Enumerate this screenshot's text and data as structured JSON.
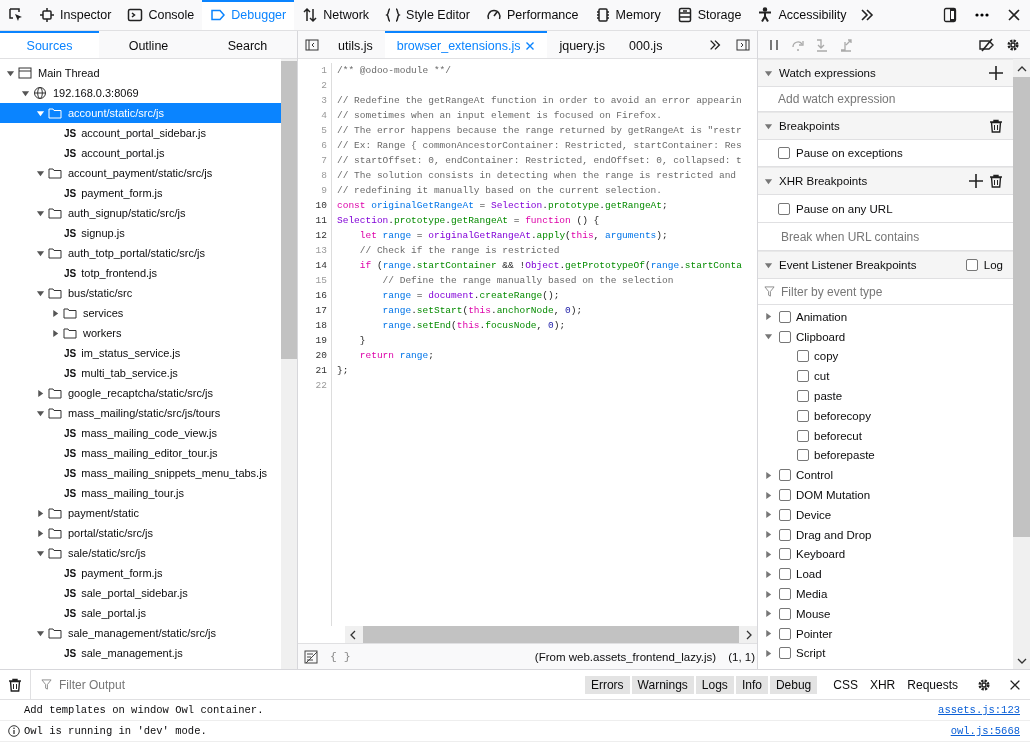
{
  "toolbox": {
    "tools": [
      {
        "label": "Inspector",
        "selected": false
      },
      {
        "label": "Console",
        "selected": false
      },
      {
        "label": "Debugger",
        "selected": true
      },
      {
        "label": "Network",
        "selected": false
      },
      {
        "label": "Style Editor",
        "selected": false
      },
      {
        "label": "Performance",
        "selected": false
      },
      {
        "label": "Memory",
        "selected": false
      },
      {
        "label": "Storage",
        "selected": false
      },
      {
        "label": "Accessibility",
        "selected": false
      }
    ]
  },
  "sources": {
    "tabs": [
      {
        "label": "Sources",
        "selected": true
      },
      {
        "label": "Outline",
        "selected": false
      },
      {
        "label": "Search",
        "selected": false
      }
    ],
    "tree": [
      {
        "kind": "thread",
        "label": "Main Thread",
        "expanded": true,
        "selected": false,
        "children": [
          {
            "kind": "host",
            "label": "192.168.0.3:8069",
            "expanded": true,
            "selected": false,
            "children": [
              {
                "kind": "folder",
                "label": "account/static/src/js",
                "expanded": true,
                "selected": true,
                "children": [
                  {
                    "kind": "file",
                    "badge": "JS",
                    "label": "account_portal_sidebar.js",
                    "selected": false
                  },
                  {
                    "kind": "file",
                    "badge": "JS",
                    "label": "account_portal.js",
                    "selected": false
                  }
                ]
              },
              {
                "kind": "folder",
                "label": "account_payment/static/src/js",
                "expanded": true,
                "selected": false,
                "children": [
                  {
                    "kind": "file",
                    "badge": "JS",
                    "label": "payment_form.js",
                    "selected": false
                  }
                ]
              },
              {
                "kind": "folder",
                "label": "auth_signup/static/src/js",
                "expanded": true,
                "selected": false,
                "children": [
                  {
                    "kind": "file",
                    "badge": "JS",
                    "label": "signup.js",
                    "selected": false
                  }
                ]
              },
              {
                "kind": "folder",
                "label": "auth_totp_portal/static/src/js",
                "expanded": true,
                "selected": false,
                "children": [
                  {
                    "kind": "file",
                    "badge": "JS",
                    "label": "totp_frontend.js",
                    "selected": false
                  }
                ]
              },
              {
                "kind": "folder",
                "label": "bus/static/src",
                "expanded": true,
                "selected": false,
                "children": [
                  {
                    "kind": "folder",
                    "label": "services",
                    "expanded": false,
                    "selected": false
                  },
                  {
                    "kind": "folder",
                    "label": "workers",
                    "expanded": false,
                    "selected": false
                  },
                  {
                    "kind": "file",
                    "badge": "JS",
                    "label": "im_status_service.js",
                    "selected": false
                  },
                  {
                    "kind": "file",
                    "badge": "JS",
                    "label": "multi_tab_service.js",
                    "selected": false
                  }
                ]
              },
              {
                "kind": "folder",
                "label": "google_recaptcha/static/src/js",
                "expanded": false,
                "selected": false
              },
              {
                "kind": "folder",
                "label": "mass_mailing/static/src/js/tours",
                "expanded": true,
                "selected": false,
                "children": [
                  {
                    "kind": "file",
                    "badge": "JS",
                    "label": "mass_mailing_code_view.js",
                    "selected": false
                  },
                  {
                    "kind": "file",
                    "badge": "JS",
                    "label": "mass_mailing_editor_tour.js",
                    "selected": false
                  },
                  {
                    "kind": "file",
                    "badge": "JS",
                    "label": "mass_mailing_snippets_menu_tabs.js",
                    "selected": false
                  },
                  {
                    "kind": "file",
                    "badge": "JS",
                    "label": "mass_mailing_tour.js",
                    "selected": false
                  }
                ]
              },
              {
                "kind": "folder",
                "label": "payment/static",
                "expanded": false,
                "selected": false
              },
              {
                "kind": "folder",
                "label": "portal/static/src/js",
                "expanded": false,
                "selected": false
              },
              {
                "kind": "folder",
                "label": "sale/static/src/js",
                "expanded": true,
                "selected": false,
                "children": [
                  {
                    "kind": "file",
                    "badge": "JS",
                    "label": "payment_form.js",
                    "selected": false
                  },
                  {
                    "kind": "file",
                    "badge": "JS",
                    "label": "sale_portal_sidebar.js",
                    "selected": false
                  },
                  {
                    "kind": "file",
                    "badge": "JS",
                    "label": "sale_portal.js",
                    "selected": false
                  }
                ]
              },
              {
                "kind": "folder",
                "label": "sale_management/static/src/js",
                "expanded": true,
                "selected": false,
                "children": [
                  {
                    "kind": "file",
                    "badge": "JS",
                    "label": "sale_management.js",
                    "selected": false
                  }
                ]
              }
            ]
          }
        ]
      }
    ]
  },
  "editor": {
    "tabs": [
      {
        "label": "utils.js",
        "selected": false
      },
      {
        "label": "browser_extensions.js",
        "selected": true
      },
      {
        "label": "jquery.js",
        "selected": false
      },
      {
        "label": "000.js",
        "selected": false
      }
    ],
    "lines": [
      {
        "no": "1",
        "tokens": [
          {
            "kind": "comment",
            "t": "/** @odoo-module **/"
          }
        ]
      },
      {
        "no": "2"
      },
      {
        "no": "3",
        "tokens": [
          {
            "kind": "comment",
            "t": "// Redefine the getRangeAt function in order to avoid an error appearin"
          }
        ]
      },
      {
        "no": "4",
        "tokens": [
          {
            "kind": "comment",
            "t": "// sometimes when an input element is focused on Firefox."
          }
        ]
      },
      {
        "no": "5",
        "tokens": [
          {
            "kind": "comment",
            "t": "// The error happens because the range returned by getRangeAt is \"restr"
          }
        ]
      },
      {
        "no": "6",
        "tokens": [
          {
            "kind": "comment",
            "t": "// Ex: Range { commonAncestorContainer: Restricted, startContainer: Res"
          }
        ]
      },
      {
        "no": "7",
        "tokens": [
          {
            "kind": "comment",
            "t": "// startOffset: 0, endContainer: Restricted, endOffset: 0, collapsed: t"
          }
        ]
      },
      {
        "no": "8",
        "tokens": [
          {
            "kind": "comment",
            "t": "// The solution consists in detecting when the range is restricted and"
          }
        ]
      },
      {
        "no": "9",
        "tokens": [
          {
            "kind": "comment",
            "t": "// redefining it manually based on the current selection."
          }
        ]
      },
      {
        "no": "10",
        "tokens": [
          {
            "kind": "keyword",
            "t": "const"
          },
          {
            "kind": "variable",
            "t": " originalGetRangeAt"
          },
          {
            "kind": "plain",
            "t": " = "
          },
          {
            "kind": "global",
            "t": "Selection"
          },
          {
            "kind": "plain",
            "t": "."
          },
          {
            "kind": "property",
            "t": "prototype"
          },
          {
            "kind": "plain",
            "t": "."
          },
          {
            "kind": "property",
            "t": "getRangeAt"
          },
          {
            "kind": "plain",
            "t": ";"
          }
        ]
      },
      {
        "no": "11",
        "tokens": [
          {
            "kind": "global",
            "t": "Selection"
          },
          {
            "kind": "plain",
            "t": "."
          },
          {
            "kind": "property",
            "t": "prototype"
          },
          {
            "kind": "plain",
            "t": "."
          },
          {
            "kind": "property",
            "t": "getRangeAt"
          },
          {
            "kind": "plain",
            "t": " = "
          },
          {
            "kind": "keyword",
            "t": "function"
          },
          {
            "kind": "plain",
            "t": " () {"
          }
        ]
      },
      {
        "no": "12",
        "tokens": [
          {
            "kind": "keyword",
            "t": "    let"
          },
          {
            "kind": "variable",
            "t": " range"
          },
          {
            "kind": "plain",
            "t": " = "
          },
          {
            "kind": "global",
            "t": "originalGetRangeAt"
          },
          {
            "kind": "plain",
            "t": "."
          },
          {
            "kind": "property",
            "t": "apply"
          },
          {
            "kind": "plain",
            "t": "("
          },
          {
            "kind": "keyword",
            "t": "this"
          },
          {
            "kind": "plain",
            "t": ", "
          },
          {
            "kind": "variable",
            "t": "arguments"
          },
          {
            "kind": "plain",
            "t": ");"
          }
        ]
      },
      {
        "no": "13",
        "tokens": [
          {
            "kind": "comment",
            "t": "    // Check if the range is restricted"
          }
        ]
      },
      {
        "no": "14",
        "tokens": [
          {
            "kind": "keyword",
            "t": "    if"
          },
          {
            "kind": "plain",
            "t": " ("
          },
          {
            "kind": "variable",
            "t": "range"
          },
          {
            "kind": "plain",
            "t": "."
          },
          {
            "kind": "property",
            "t": "startContainer"
          },
          {
            "kind": "plain",
            "t": " && !"
          },
          {
            "kind": "global",
            "t": "Object"
          },
          {
            "kind": "plain",
            "t": "."
          },
          {
            "kind": "property",
            "t": "getPrototypeOf"
          },
          {
            "kind": "plain",
            "t": "("
          },
          {
            "kind": "variable",
            "t": "range"
          },
          {
            "kind": "plain",
            "t": "."
          },
          {
            "kind": "property",
            "t": "startConta"
          }
        ]
      },
      {
        "no": "15",
        "tokens": [
          {
            "kind": "comment",
            "t": "        // Define the range manually based on the selection"
          }
        ]
      },
      {
        "no": "16",
        "tokens": [
          {
            "kind": "variable",
            "t": "        range"
          },
          {
            "kind": "plain",
            "t": " = "
          },
          {
            "kind": "global",
            "t": "document"
          },
          {
            "kind": "plain",
            "t": "."
          },
          {
            "kind": "property",
            "t": "createRange"
          },
          {
            "kind": "plain",
            "t": "();"
          }
        ]
      },
      {
        "no": "17",
        "tokens": [
          {
            "kind": "variable",
            "t": "        range"
          },
          {
            "kind": "plain",
            "t": "."
          },
          {
            "kind": "property",
            "t": "setStart"
          },
          {
            "kind": "plain",
            "t": "("
          },
          {
            "kind": "keyword",
            "t": "this"
          },
          {
            "kind": "plain",
            "t": "."
          },
          {
            "kind": "property",
            "t": "anchorNode"
          },
          {
            "kind": "plain",
            "t": ", "
          },
          {
            "kind": "number",
            "t": "0"
          },
          {
            "kind": "plain",
            "t": ");"
          }
        ]
      },
      {
        "no": "18",
        "tokens": [
          {
            "kind": "variable",
            "t": "        range"
          },
          {
            "kind": "plain",
            "t": "."
          },
          {
            "kind": "property",
            "t": "setEnd"
          },
          {
            "kind": "plain",
            "t": "("
          },
          {
            "kind": "keyword",
            "t": "this"
          },
          {
            "kind": "plain",
            "t": "."
          },
          {
            "kind": "property",
            "t": "focusNode"
          },
          {
            "kind": "plain",
            "t": ", "
          },
          {
            "kind": "number",
            "t": "0"
          },
          {
            "kind": "plain",
            "t": ");"
          }
        ]
      },
      {
        "no": "19",
        "tokens": [
          {
            "kind": "plain",
            "t": "    }"
          }
        ]
      },
      {
        "no": "20",
        "tokens": [
          {
            "kind": "keyword",
            "t": "    return"
          },
          {
            "kind": "variable",
            "t": " range"
          },
          {
            "kind": "plain",
            "t": ";"
          }
        ]
      },
      {
        "no": "21",
        "tokens": [
          {
            "kind": "plain",
            "t": "};"
          }
        ]
      },
      {
        "no": "22"
      }
    ],
    "footer": {
      "pretty": "{ }",
      "source": "(From web.assets_frontend_lazy.js)",
      "position": "(1, 1)"
    }
  },
  "panes": {
    "watch": {
      "title": "Watch expressions",
      "expanded": true,
      "placeholder": "Add watch expression"
    },
    "breakpoints": {
      "title": "Breakpoints",
      "expanded": true,
      "options": [
        {
          "label": "Pause on exceptions",
          "checked": false
        }
      ]
    },
    "xhr": {
      "title": "XHR Breakpoints",
      "expanded": true,
      "options": [
        {
          "label": "Pause on any URL",
          "checked": false
        }
      ],
      "placeholder": "Break when URL contains"
    },
    "events": {
      "title": "Event Listener Breakpoints",
      "expanded": true,
      "log": {
        "label": "Log",
        "checked": false
      },
      "filter_placeholder": "Filter by event type",
      "categories": [
        {
          "label": "Animation",
          "checked": false,
          "expanded": false
        },
        {
          "label": "Clipboard",
          "checked": false,
          "expanded": true,
          "children": [
            {
              "label": "copy",
              "checked": false
            },
            {
              "label": "cut",
              "checked": false
            },
            {
              "label": "paste",
              "checked": false
            },
            {
              "label": "beforecopy",
              "checked": false
            },
            {
              "label": "beforecut",
              "checked": false
            },
            {
              "label": "beforepaste",
              "checked": false
            }
          ]
        },
        {
          "label": "Control",
          "checked": false,
          "expanded": false
        },
        {
          "label": "DOM Mutation",
          "checked": false,
          "expanded": false
        },
        {
          "label": "Device",
          "checked": false,
          "expanded": false
        },
        {
          "label": "Drag and Drop",
          "checked": false,
          "expanded": false
        },
        {
          "label": "Keyboard",
          "checked": false,
          "expanded": false
        },
        {
          "label": "Load",
          "checked": false,
          "expanded": false
        },
        {
          "label": "Media",
          "checked": false,
          "expanded": false
        },
        {
          "label": "Mouse",
          "checked": false,
          "expanded": false
        },
        {
          "label": "Pointer",
          "checked": false,
          "expanded": false
        },
        {
          "label": "Script",
          "checked": false,
          "expanded": false
        }
      ]
    }
  },
  "console": {
    "filter_placeholder": "Filter Output",
    "levels": [
      {
        "label": "Errors",
        "on": true
      },
      {
        "label": "Warnings",
        "on": true
      },
      {
        "label": "Logs",
        "on": true
      },
      {
        "label": "Info",
        "on": true
      },
      {
        "label": "Debug",
        "on": true
      }
    ],
    "types": [
      {
        "label": "CSS",
        "on": false
      },
      {
        "label": "XHR",
        "on": false
      },
      {
        "label": "Requests",
        "on": false
      }
    ],
    "messages": [
      {
        "kind": "log",
        "text": "Add templates on window Owl container.",
        "source": "assets.js:123"
      },
      {
        "kind": "info",
        "text": "Owl is running in 'dev' mode.",
        "source": "owl.js:5668"
      }
    ]
  }
}
